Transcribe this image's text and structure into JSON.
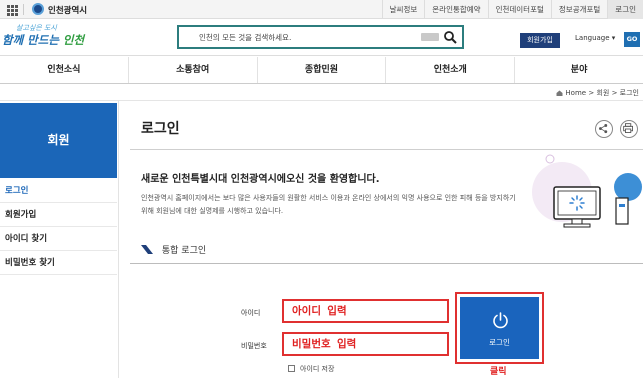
{
  "topbar": {
    "site_name": "인천광역시",
    "links": [
      "날씨정보",
      "온라인통합예약",
      "인천데이터포털",
      "정보공개포털",
      "로그인"
    ]
  },
  "header": {
    "slogan_top": "살고싶은 도시",
    "slogan_main_a": "함께 만드는 ",
    "slogan_main_b": "인천",
    "search_placeholder": "인천의 모든 것을 검색하세요.",
    "join_label": "회원가입",
    "language_label": "Language",
    "language_arrow": "▾",
    "go_label": "GO"
  },
  "gnb": [
    "인천소식",
    "소통참여",
    "종합민원",
    "인천소개",
    "분야"
  ],
  "breadcrumb": {
    "home": "Home",
    "sep": ">",
    "level1": "회원",
    "current": "로그인"
  },
  "sidebar": {
    "title": "회원",
    "items": [
      {
        "label": "로그인",
        "active": true
      },
      {
        "label": "회원가입",
        "active": false
      },
      {
        "label": "아이디 찾기",
        "active": false
      },
      {
        "label": "비밀번호 찾기",
        "active": false
      }
    ]
  },
  "content": {
    "page_title": "로그인",
    "welcome": "새로운 인천특별시대 인천광역시에오신 것을 환영합니다.",
    "description": "인천광역시 홈페이지에서는 보다 많은 사용자들의 원활한 서비스 이용과 온라인 상에서의 익명 사용으로 인한 피해 등을 방지하기 위해 회원님에 대한 실명제를 시행하고 있습니다.",
    "section_title": "통합 로그인",
    "id_label": "아이디",
    "id_placeholder": "아이디 입력",
    "pw_label": "비밀번호",
    "pw_placeholder": "비밀번호 입력",
    "login_button": "로그인",
    "save_id_label": "아이디 저장",
    "click_note": "클릭"
  },
  "colors": {
    "primary_blue": "#1b66b8",
    "navy": "#1f3f7a",
    "search_border": "#2c7d7e",
    "annotation_red": "#e02020"
  },
  "icons": [
    "menu-grid-icon",
    "city-logo-icon",
    "search-icon",
    "home-icon",
    "share-icon",
    "print-icon",
    "power-icon",
    "section-mark-icon"
  ]
}
